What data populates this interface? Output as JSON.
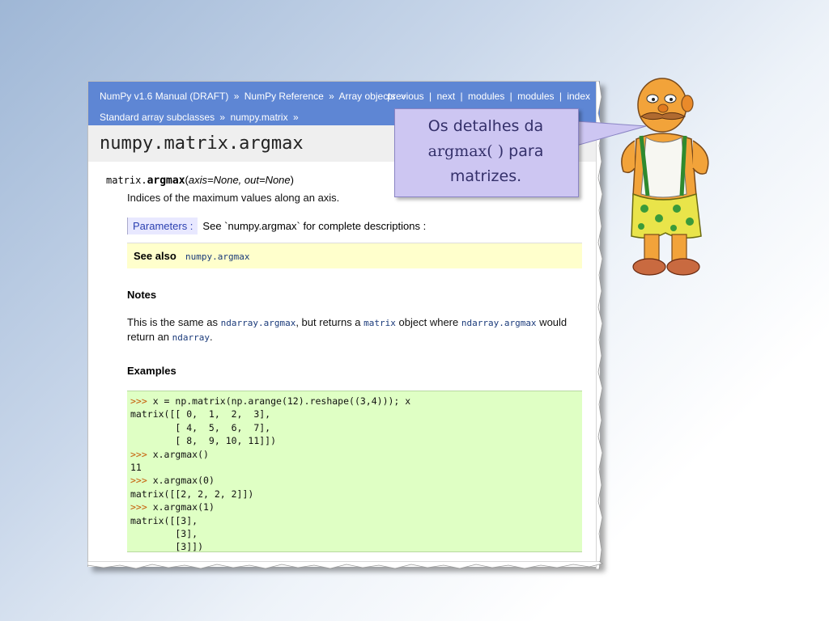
{
  "relbar": {
    "manual": "NumPy v1.6 Manual (DRAFT)",
    "reference": "NumPy Reference",
    "array_objects": "Array objects",
    "subclasses": "Standard array subclasses",
    "matrix": "numpy.matrix",
    "sep": "»",
    "previous": "previous",
    "next": "next",
    "modules1": "modules",
    "modules2": "modules",
    "index": "index",
    "bar": "|"
  },
  "page": {
    "title": "numpy.matrix.argmax",
    "sig_class": "matrix.",
    "sig_func": "argmax",
    "sig_args": "axis=None, out=None",
    "description": "Indices of the maximum values along an axis.",
    "params_label": "Parameters :",
    "params_text": "See `numpy.argmax` for complete descriptions :",
    "seealso_label": "See also",
    "seealso_link": "numpy.argmax",
    "notes_heading": "Notes",
    "notes_a": "This is the same as ",
    "notes_code1": "ndarray.argmax",
    "notes_b": ", but returns a ",
    "notes_code2": "matrix",
    "notes_c": " object where ",
    "notes_code3": "ndarray.argmax",
    "notes_d": " would return an ",
    "notes_code4": "ndarray",
    "notes_e": ".",
    "examples_heading": "Examples",
    "code_lines": [
      ">>> x = np.matrix(np.arange(12).reshape((3,4))); x",
      "matrix([[ 0,  1,  2,  3],",
      "        [ 4,  5,  6,  7],",
      "        [ 8,  9, 10, 11]])",
      ">>> x.argmax()",
      "11",
      ">>> x.argmax(0)",
      "matrix([[2, 2, 2, 2]])",
      ">>> x.argmax(1)",
      "matrix([[3],",
      "        [3],",
      "        [3]])"
    ]
  },
  "callout": {
    "line1": "Os detalhes da",
    "line2a": "argmax( )",
    "line2b": " para",
    "line3": "matrizes."
  },
  "colors": {
    "relbar": "#5e86d4",
    "callout": "#cdc6f2",
    "code_bg": "#dfffc4",
    "seealso_bg": "#ffffcc"
  }
}
